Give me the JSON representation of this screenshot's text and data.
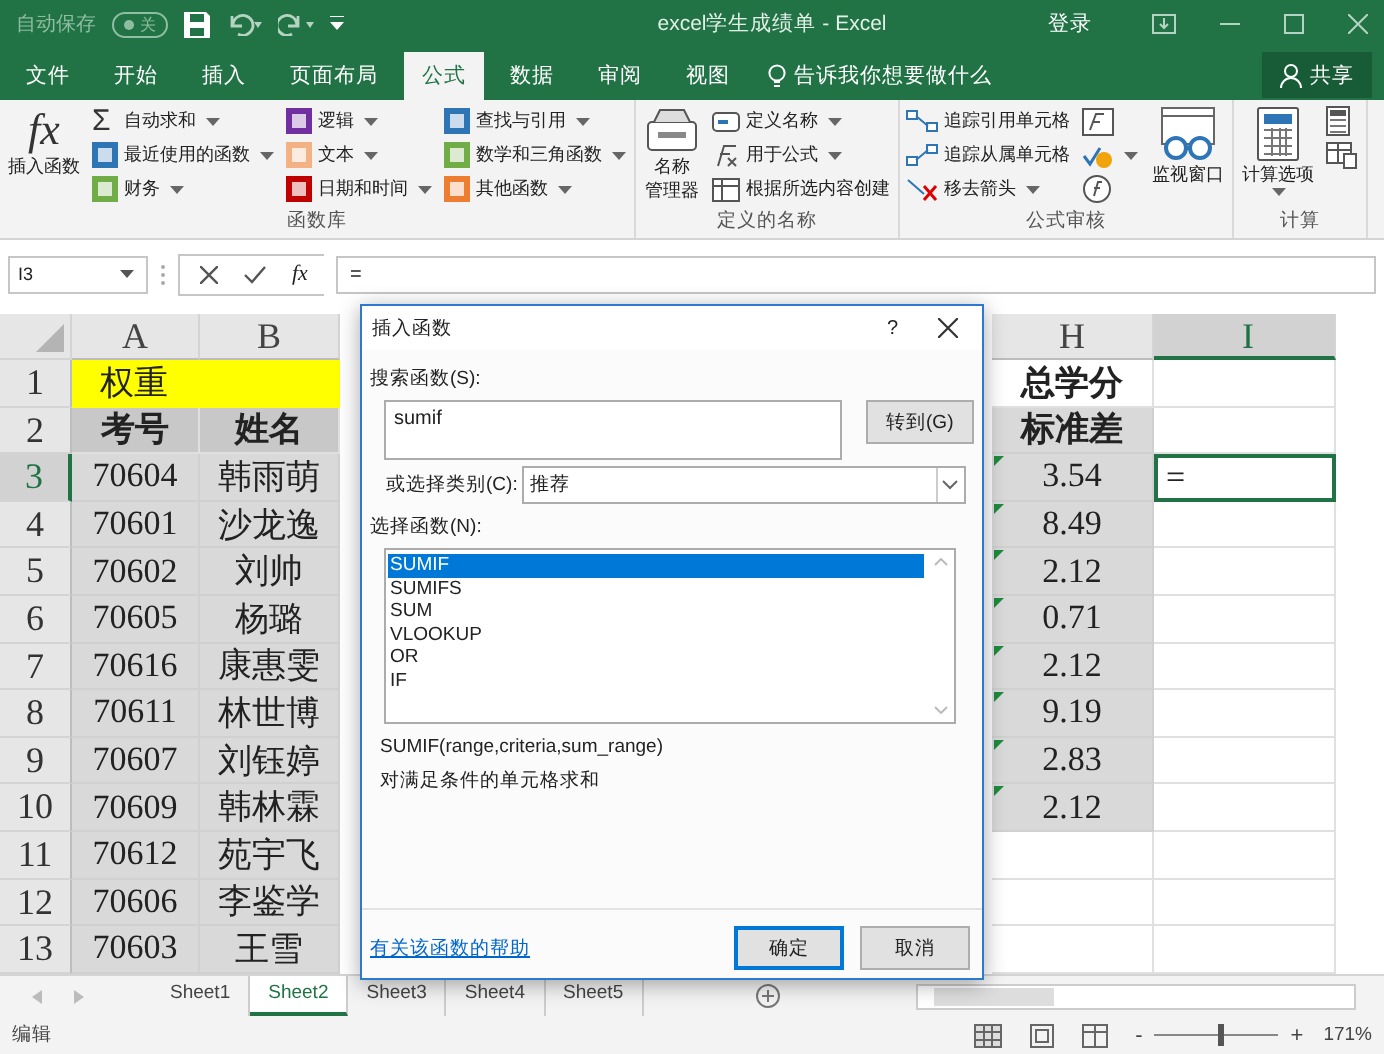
{
  "title_bar": {
    "autosave": "自动保存",
    "toggle_label": "关",
    "title": "excel学生成绩单 - Excel",
    "sign_in": "登录"
  },
  "tabs": [
    {
      "label": "文件",
      "selected": false
    },
    {
      "label": "开始",
      "selected": false
    },
    {
      "label": "插入",
      "selected": false
    },
    {
      "label": "页面布局",
      "selected": false
    },
    {
      "label": "公式",
      "selected": true
    },
    {
      "label": "数据",
      "selected": false
    },
    {
      "label": "审阅",
      "selected": false
    },
    {
      "label": "视图",
      "selected": false
    }
  ],
  "tell_me": {
    "placeholder": "告诉我你想要做什么"
  },
  "share": "共享",
  "ribbon": {
    "groups": [
      {
        "label": "函数库",
        "parts": [
          {
            "kind": "large",
            "label_lines": [
              "插入函数"
            ],
            "symbol": "fx"
          },
          {
            "kind": "column",
            "items": [
              {
                "label": "自动求和",
                "symbol": "Σ",
                "dropdown": true
              },
              {
                "label": "最近使用的函数",
                "color": "#2e75b6",
                "dropdown": true
              },
              {
                "label": "财务",
                "color": "#70ad47",
                "dropdown": true
              }
            ]
          },
          {
            "kind": "column",
            "items": [
              {
                "label": "逻辑",
                "color": "#7030a0",
                "dropdown": true
              },
              {
                "label": "文本",
                "color": "#f4b183",
                "dropdown": true
              },
              {
                "label": "日期和时间",
                "color": "#c00000",
                "dropdown": true
              }
            ]
          },
          {
            "kind": "column",
            "items": [
              {
                "label": "查找与引用",
                "color": "#2e75b6",
                "dropdown": true
              },
              {
                "label": "数学和三角函数",
                "color": "#70ad47",
                "dropdown": true
              },
              {
                "label": "其他函数",
                "color": "#ed7d31",
                "dropdown": true
              }
            ]
          }
        ]
      },
      {
        "label": "定义的名称",
        "parts": [
          {
            "kind": "large",
            "label_lines": [
              "名称",
              "管理器"
            ]
          },
          {
            "kind": "column",
            "items": [
              {
                "label": "定义名称",
                "dropdown": true
              },
              {
                "label": "用于公式",
                "dropdown": true
              },
              {
                "label": "根据所选内容创建",
                "dropdown": false
              }
            ]
          }
        ]
      },
      {
        "label": "公式审核",
        "parts": [
          {
            "kind": "column",
            "items": [
              {
                "label": "追踪引用单元格",
                "dropdown": false
              },
              {
                "label": "追踪从属单元格",
                "dropdown": false
              },
              {
                "label": "移去箭头",
                "dropdown": true
              }
            ]
          },
          {
            "kind": "column",
            "items": [
              {
                "dropdown": false
              },
              {
                "dropdown": true
              },
              {
                "dropdown": false
              }
            ]
          },
          {
            "kind": "large",
            "label_lines": [
              "监视窗口"
            ]
          }
        ]
      },
      {
        "label": "计算",
        "parts": [
          {
            "kind": "large",
            "label_lines": [
              "计算选项"
            ],
            "dropdown": true
          },
          {
            "kind": "column",
            "items": [
              {
                "dropdown": false
              },
              {
                "dropdown": false
              }
            ]
          }
        ]
      }
    ]
  },
  "formula_bar": {
    "name_box": "I3",
    "symbol": "fx",
    "formula": "="
  },
  "grid": {
    "columns": [
      {
        "label": "A",
        "selected": false
      },
      {
        "label": "B",
        "selected": false
      },
      {
        "label": "H",
        "selected": false
      },
      {
        "label": "I",
        "selected": true
      }
    ],
    "rows": [
      {
        "number": "1",
        "kind": "weight",
        "selected": false,
        "flagged": false,
        "cells": {
          "A": "权重",
          "H": "总学分"
        }
      },
      {
        "number": "2",
        "kind": "header",
        "selected": false,
        "flagged": false,
        "cells": {
          "A": "考号",
          "B": "姓名",
          "H": "标准差"
        }
      },
      {
        "number": "3",
        "kind": "data",
        "selected": true,
        "flagged": true,
        "cells": {
          "A": "70604",
          "B": "韩雨萌",
          "H": "3.54",
          "I": "="
        }
      },
      {
        "number": "4",
        "kind": "data",
        "selected": false,
        "flagged": true,
        "cells": {
          "A": "70601",
          "B": "沙龙逸",
          "H": "8.49"
        }
      },
      {
        "number": "5",
        "kind": "data",
        "selected": false,
        "flagged": true,
        "cells": {
          "A": "70602",
          "B": "刘帅",
          "H": "2.12"
        }
      },
      {
        "number": "6",
        "kind": "data",
        "selected": false,
        "flagged": true,
        "cells": {
          "A": "70605",
          "B": "杨璐",
          "H": "0.71"
        }
      },
      {
        "number": "7",
        "kind": "data",
        "selected": false,
        "flagged": true,
        "cells": {
          "A": "70616",
          "B": "康惠雯",
          "H": "2.12"
        }
      },
      {
        "number": "8",
        "kind": "data",
        "selected": false,
        "flagged": true,
        "cells": {
          "A": "70611",
          "B": "林世博",
          "H": "9.19"
        }
      },
      {
        "number": "9",
        "kind": "data",
        "selected": false,
        "flagged": true,
        "cells": {
          "A": "70607",
          "B": "刘钰婷",
          "H": "2.83"
        }
      },
      {
        "number": "10",
        "kind": "data",
        "selected": false,
        "flagged": true,
        "cells": {
          "A": "70609",
          "B": "韩林霖",
          "H": "2.12"
        }
      },
      {
        "number": "11",
        "kind": "data",
        "selected": false,
        "flagged": false,
        "cells": {
          "A": "70612",
          "B": "苑宇飞"
        }
      },
      {
        "number": "12",
        "kind": "data",
        "selected": false,
        "flagged": false,
        "cells": {
          "A": "70606",
          "B": "李鉴学"
        }
      },
      {
        "number": "13",
        "kind": "data",
        "selected": false,
        "flagged": false,
        "cells": {
          "A": "70603",
          "B": "王雪"
        }
      }
    ]
  },
  "dialog": {
    "title": "插入函数",
    "help": "?",
    "search_label": "搜索函数(S):",
    "search_value": "sumif",
    "go_button": "转到(G)",
    "category_label": "或选择类别(C):",
    "category_value": "推荐",
    "list_label": "选择函数(N):",
    "functions": [
      {
        "label": "SUMIF",
        "selected": true
      },
      {
        "label": "SUMIFS",
        "selected": false
      },
      {
        "label": "SUM",
        "selected": false
      },
      {
        "label": "VLOOKUP",
        "selected": false
      },
      {
        "label": "OR",
        "selected": false
      },
      {
        "label": "IF",
        "selected": false
      }
    ],
    "signature": "SUMIF(range,criteria,sum_range)",
    "description": "对满足条件的单元格求和",
    "help_link": "有关该函数的帮助",
    "buttons": [
      {
        "label": "确定",
        "default": true
      },
      {
        "label": "取消",
        "default": false
      }
    ]
  },
  "sheets": [
    {
      "label": "Sheet1",
      "selected": false
    },
    {
      "label": "Sheet2",
      "selected": true
    },
    {
      "label": "Sheet3",
      "selected": false
    },
    {
      "label": "Sheet4",
      "selected": false
    },
    {
      "label": "Sheet5",
      "selected": false
    }
  ],
  "status_bar": {
    "mode": "编辑",
    "zoom_out": "-",
    "zoom_in": "+",
    "zoom": "171%",
    "zoom_slider": {
      "level": 0.55
    }
  }
}
